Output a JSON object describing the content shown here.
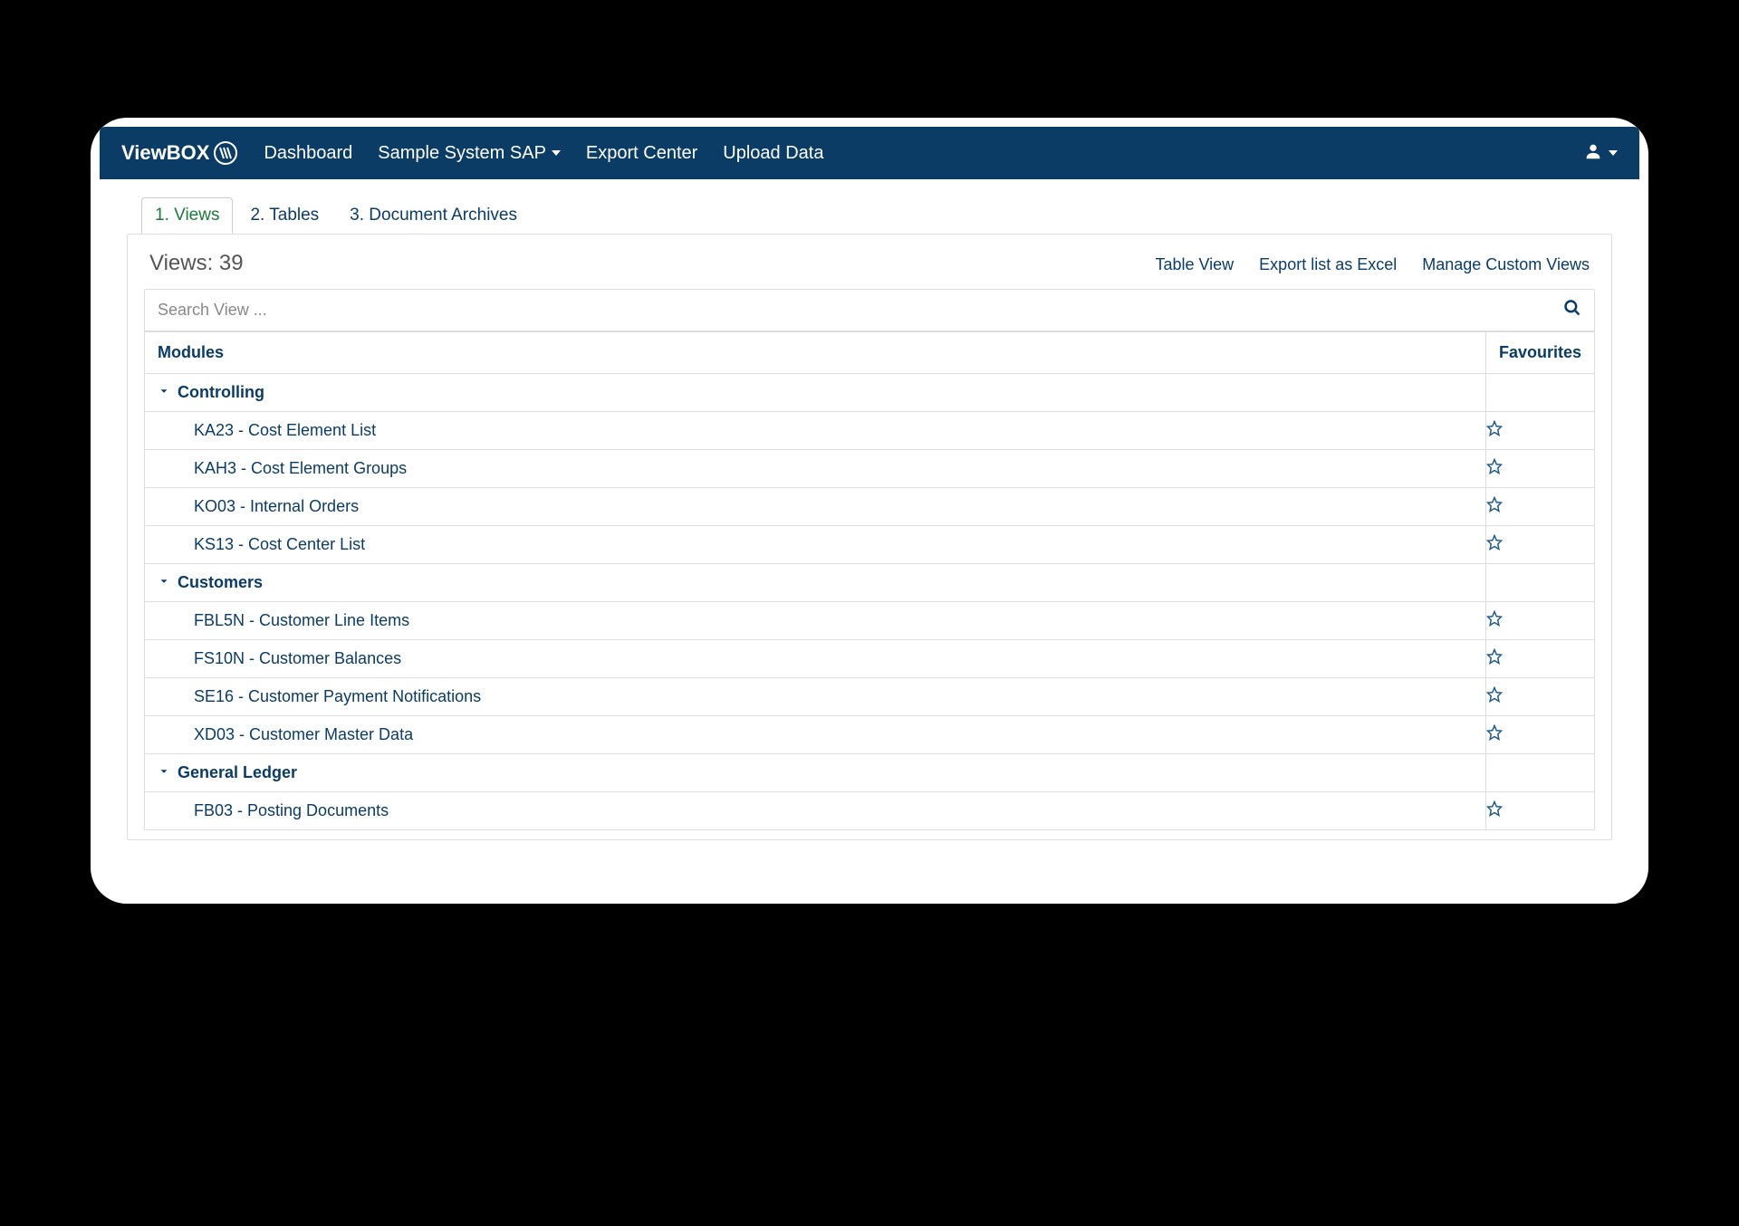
{
  "brand": {
    "prefix": "View",
    "suffix": "BOX"
  },
  "nav": {
    "dashboard": "Dashboard",
    "system": "Sample System SAP",
    "export_center": "Export Center",
    "upload_data": "Upload Data"
  },
  "tabs": {
    "views": "1. Views",
    "tables": "2. Tables",
    "archives": "3. Document Archives"
  },
  "views": {
    "title": "Views: 39",
    "actions": {
      "table_view": "Table View",
      "export_excel": "Export list as Excel",
      "manage_custom": "Manage Custom Views"
    },
    "search_placeholder": "Search View ...",
    "columns": {
      "modules": "Modules",
      "favourites": "Favourites"
    },
    "groups": [
      {
        "name": "Controlling",
        "items": [
          "KA23 - Cost Element List",
          "KAH3 - Cost Element Groups",
          "KO03 - Internal Orders",
          "KS13 - Cost Center List"
        ]
      },
      {
        "name": "Customers",
        "items": [
          "FBL5N - Customer Line Items",
          "FS10N - Customer Balances",
          "SE16 - Customer Payment Notifications",
          "XD03 - Customer Master Data"
        ]
      },
      {
        "name": "General Ledger",
        "items": [
          "FB03 - Posting Documents"
        ]
      }
    ]
  }
}
